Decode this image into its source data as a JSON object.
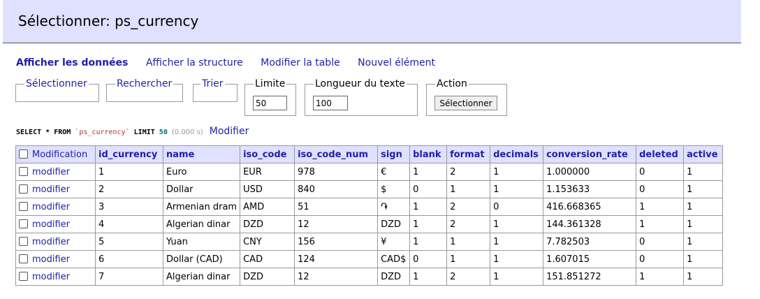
{
  "header": {
    "title": "Sélectionner: ps_currency"
  },
  "nav": {
    "items": [
      "Afficher les données",
      "Afficher la structure",
      "Modifier la table",
      "Nouvel élément"
    ]
  },
  "filters": {
    "select_label": "Sélectionner",
    "search_label": "Rechercher",
    "sort_label": "Trier",
    "limit_label": "Limite",
    "limit_value": "50",
    "text_length_label": "Longueur du texte",
    "text_length_value": "100",
    "action_label": "Action",
    "action_button": "Sélectionner"
  },
  "query": {
    "select_kw": "SELECT",
    "star": "*",
    "from_kw": "FROM",
    "table": "`ps_currency`",
    "limit_kw": "LIMIT",
    "limit": "50",
    "time": "(0.000 s)",
    "edit_link": "Modifier"
  },
  "table": {
    "mod_header": "Modification",
    "columns": [
      "id_currency",
      "name",
      "iso_code",
      "iso_code_num",
      "sign",
      "blank",
      "format",
      "decimals",
      "conversion_rate",
      "deleted",
      "active"
    ],
    "row_link": "modifier",
    "rows": [
      [
        "1",
        "Euro",
        "EUR",
        "978",
        "€",
        "1",
        "2",
        "1",
        "1.000000",
        "0",
        "1"
      ],
      [
        "2",
        "Dollar",
        "USD",
        "840",
        "$",
        "0",
        "1",
        "1",
        "1.153633",
        "0",
        "1"
      ],
      [
        "3",
        "Armenian dram",
        "AMD",
        "51",
        "֏",
        "1",
        "2",
        "0",
        "416.668365",
        "1",
        "1"
      ],
      [
        "4",
        "Algerian dinar",
        "DZD",
        "12",
        "DZD",
        "1",
        "2",
        "1",
        "144.361328",
        "1",
        "1"
      ],
      [
        "5",
        "Yuan",
        "CNY",
        "156",
        "¥",
        "1",
        "1",
        "1",
        "7.782503",
        "0",
        "1"
      ],
      [
        "6",
        "Dollar (CAD)",
        "CAD",
        "124",
        "CAD$",
        "0",
        "1",
        "1",
        "1.607015",
        "0",
        "1"
      ],
      [
        "7",
        "Algerian dinar",
        "DZD",
        "12",
        "DZD",
        "1",
        "2",
        "1",
        "151.851272",
        "1",
        "1"
      ]
    ]
  }
}
